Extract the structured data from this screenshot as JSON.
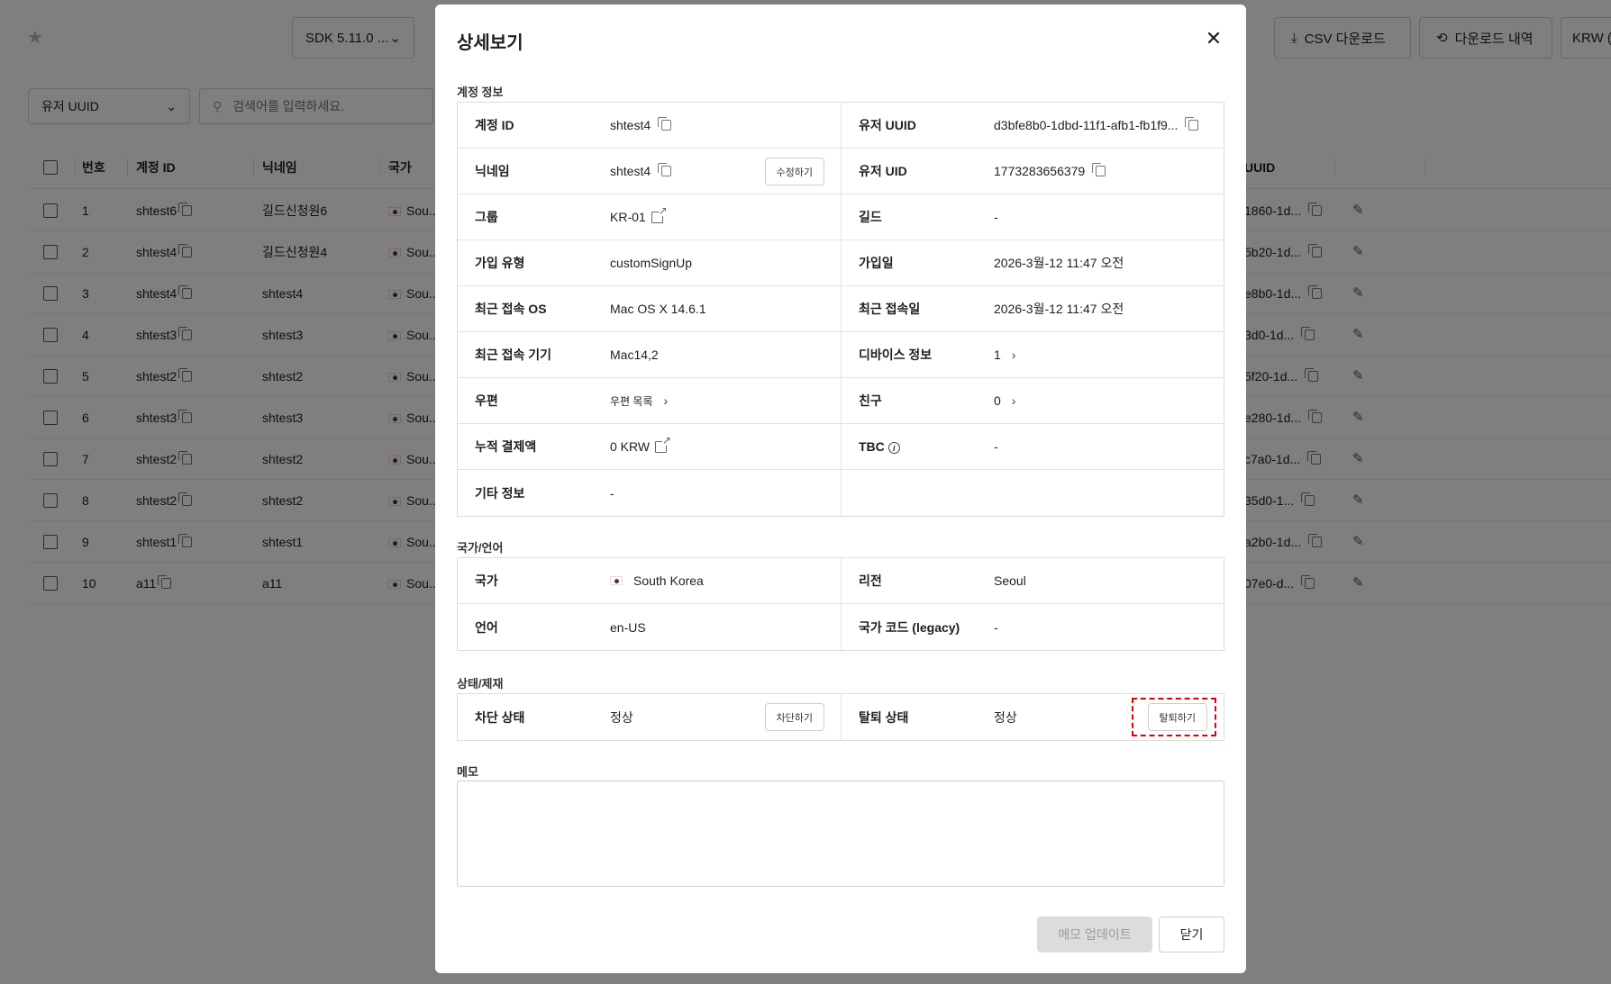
{
  "background": {
    "sdk_select": "SDK 5.11.0 ...",
    "csv_button": "CSV 다운로드",
    "history_button": "다운로드 내역",
    "currency_button": "KRW (",
    "filter_select": "유저 UUID",
    "search_placeholder": "검색어를 입력하세요.",
    "columns": {
      "number": "번호",
      "account_id": "계정 ID",
      "nickname": "닉네임",
      "country": "국가",
      "uuid": "UUID"
    },
    "rows": [
      {
        "no": "1",
        "account": "shtest6",
        "nick": "길드신청원6",
        "country": "Sou...",
        "uuid": "1860-1d..."
      },
      {
        "no": "2",
        "account": "shtest4",
        "nick": "길드신청원4",
        "country": "Sou...",
        "uuid": "5b20-1d..."
      },
      {
        "no": "3",
        "account": "shtest4",
        "nick": "shtest4",
        "country": "Sou...",
        "uuid": "e8b0-1d..."
      },
      {
        "no": "4",
        "account": "shtest3",
        "nick": "shtest3",
        "country": "Sou...",
        "uuid": "3d0-1d..."
      },
      {
        "no": "5",
        "account": "shtest2",
        "nick": "shtest2",
        "country": "Sou...",
        "uuid": "5f20-1d..."
      },
      {
        "no": "6",
        "account": "shtest3",
        "nick": "shtest3",
        "country": "Sou...",
        "uuid": "e280-1d..."
      },
      {
        "no": "7",
        "account": "shtest2",
        "nick": "shtest2",
        "country": "Sou...",
        "uuid": "c7a0-1d..."
      },
      {
        "no": "8",
        "account": "shtest2",
        "nick": "shtest2",
        "country": "Sou...",
        "uuid": "35d0-1..."
      },
      {
        "no": "9",
        "account": "shtest1",
        "nick": "shtest1",
        "country": "Sou...",
        "uuid": "a2b0-1d..."
      },
      {
        "no": "10",
        "account": "a11",
        "nick": "a11",
        "country": "Sou...",
        "uuid": "07e0-d..."
      }
    ]
  },
  "modal": {
    "title": "상세보기",
    "close_symbol": "✕",
    "account_section": "계정 정보",
    "account_rows": [
      [
        {
          "label": "계정 ID",
          "value": "shtest4"
        },
        {
          "label": "유저 UUID",
          "value": "d3bfe8b0-1dbd-11f1-afb1-fb1f9..."
        }
      ],
      [
        {
          "label": "닉네임",
          "value": "shtest4",
          "button": "수정하기"
        },
        {
          "label": "유저 UID",
          "value": "1773283656379"
        }
      ],
      [
        {
          "label": "그룹",
          "value": "KR-01"
        },
        {
          "label": "길드",
          "value": "-"
        }
      ],
      [
        {
          "label": "가입 유형",
          "value": "customSignUp"
        },
        {
          "label": "가입일",
          "value": "2026-3월-12 11:47 오전"
        }
      ],
      [
        {
          "label": "최근 접속 OS",
          "value": "Mac OS X 14.6.1"
        },
        {
          "label": "최근 접속일",
          "value": "2026-3월-12 11:47 오전"
        }
      ],
      [
        {
          "label": "최근 접속 기기",
          "value": "Mac14,2"
        },
        {
          "label": "디바이스 정보",
          "value": "1"
        }
      ],
      [
        {
          "label": "우편",
          "value": "우편 목록"
        },
        {
          "label": "친구",
          "value": "0"
        }
      ],
      [
        {
          "label": "누적 결제액",
          "value": "0 KRW"
        },
        {
          "label": "TBC",
          "value": "-"
        }
      ],
      [
        {
          "label": "기타 정보",
          "value": "-"
        },
        {
          "label": "",
          "value": ""
        }
      ]
    ],
    "locale_section": "국가/언어",
    "locale_rows": [
      [
        {
          "label": "국가",
          "value": "South Korea"
        },
        {
          "label": "리전",
          "value": "Seoul"
        }
      ],
      [
        {
          "label": "언어",
          "value": "en-US"
        },
        {
          "label": "국가 코드 (legacy)",
          "value": "-"
        }
      ]
    ],
    "status_section": "상태/제재",
    "status_row": [
      {
        "label": "차단 상태",
        "value": "정상",
        "button": "차단하기"
      },
      {
        "label": "탈퇴 상태",
        "value": "정상",
        "button": "탈퇴하기"
      }
    ],
    "memo_label": "메모",
    "memo_value": "",
    "update_button": "메모 업데이트",
    "close_button": "닫기"
  }
}
